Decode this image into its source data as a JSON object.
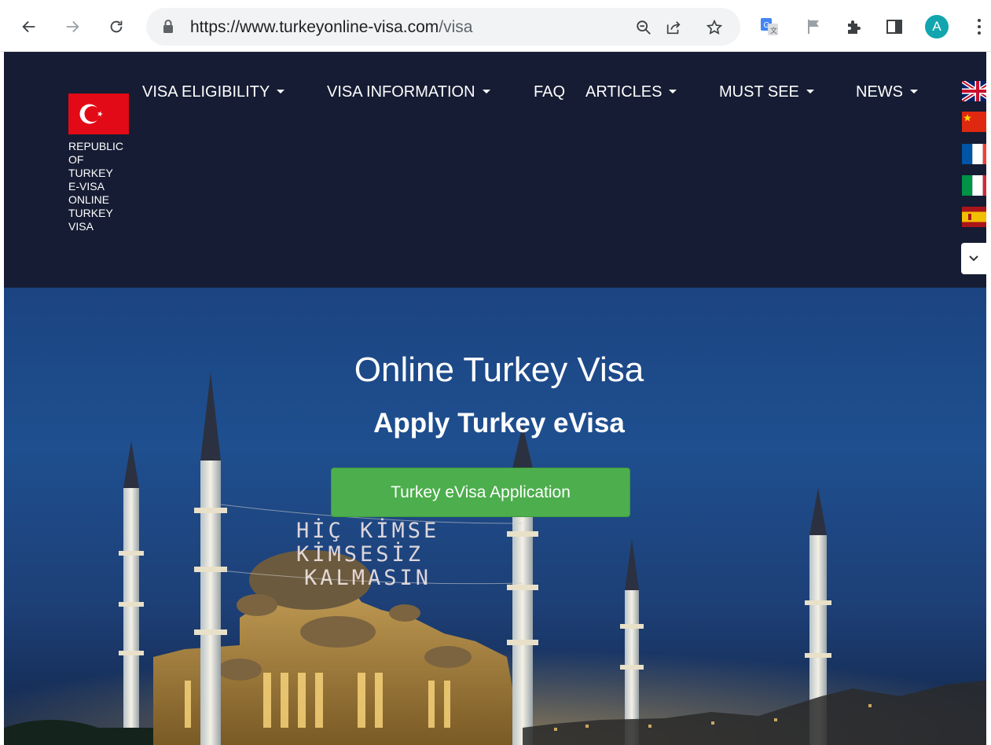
{
  "browser": {
    "url_host": "https://www.turkeyonline-visa.com",
    "url_path": "/visa",
    "avatar_letter": "A"
  },
  "site": {
    "brand_lines": [
      "REPUBLIC",
      "OF",
      "TURKEY",
      "E-VISA",
      "ONLINE",
      "TURKEY",
      "VISA"
    ],
    "menu": [
      {
        "label": "VISA ELIGIBILITY",
        "dropdown": true
      },
      {
        "label": "VISA INFORMATION",
        "dropdown": true
      },
      {
        "label": "FAQ",
        "dropdown": false
      },
      {
        "label": "ARTICLES",
        "dropdown": true
      },
      {
        "label": "MUST SEE",
        "dropdown": true
      },
      {
        "label": "NEWS",
        "dropdown": true
      }
    ],
    "languages": [
      "english-flag",
      "chinese-flag",
      "french-flag",
      "italian-flag",
      "spanish-flag"
    ],
    "colors": {
      "header_bg": "#151c33",
      "cta_bg": "#4cae4c",
      "flag_red": "#e30a17"
    }
  },
  "hero": {
    "title": "Online Turkey Visa",
    "subtitle": "Apply Turkey eVisa",
    "cta_label": "Turkey eVisa Application",
    "mahya_lines": [
      "HİÇ KİMSE",
      "KİMSESİZ",
      "KALMASIN"
    ]
  }
}
